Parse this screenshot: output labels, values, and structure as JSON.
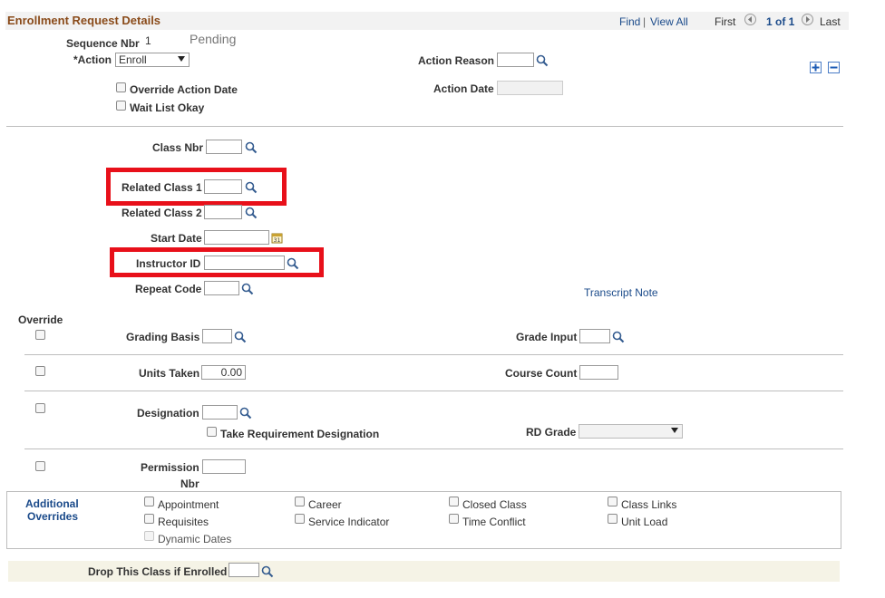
{
  "header": {
    "title": "Enrollment Request Details",
    "find": "Find",
    "sep": "|",
    "view_all": "View All",
    "first": "First",
    "range": "1 of 1",
    "last": "Last"
  },
  "request": {
    "sequence_label": "Sequence Nbr",
    "sequence_value": "1",
    "status": "Pending",
    "action_label": "*Action",
    "action_value": "Enroll",
    "action_reason_label": "Action Reason",
    "override_action_date": "Override Action Date",
    "action_date_label": "Action Date",
    "wait_list_okay": "Wait List Okay"
  },
  "class": {
    "class_nbr_label": "Class Nbr",
    "related1_label": "Related Class 1",
    "related2_label": "Related Class 2",
    "start_date_label": "Start Date",
    "instructor_label": "Instructor ID",
    "repeat_label": "Repeat Code",
    "transcript_note": "Transcript Note"
  },
  "override": {
    "header": "Override",
    "grading_basis_label": "Grading Basis",
    "grade_input_label": "Grade Input",
    "units_taken_label": "Units Taken",
    "units_taken_value": "0.00",
    "course_count_label": "Course Count",
    "designation_label": "Designation",
    "take_req_label": "Take Requirement Designation",
    "rd_grade_label": "RD Grade",
    "permission_label_1": "Permission",
    "permission_label_2": "Nbr"
  },
  "additional": {
    "label_1": "Additional",
    "label_2": "Overrides",
    "items": {
      "appointment": "Appointment",
      "career": "Career",
      "closed_class": "Closed Class",
      "class_links": "Class Links",
      "requisites": "Requisites",
      "service_indicator": "Service Indicator",
      "time_conflict": "Time Conflict",
      "unit_load": "Unit Load",
      "dynamic_dates": "Dynamic Dates"
    }
  },
  "drop": {
    "label": "Drop This Class if Enrolled"
  },
  "colors": {
    "title": "#8a4b1a",
    "link": "#1a4a8a",
    "highlight": "#e8101a",
    "drop_bar": "#f5f3e6"
  },
  "icons": [
    "search-icon",
    "calendar-icon",
    "add-row-icon",
    "delete-row-icon",
    "first-arrow-icon",
    "last-arrow-icon"
  ]
}
